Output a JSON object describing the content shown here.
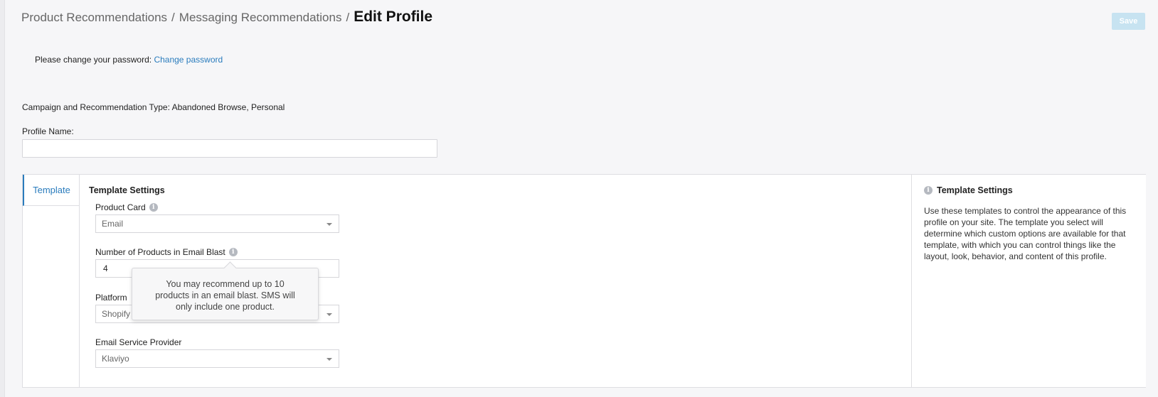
{
  "breadcrumb": {
    "items": [
      "Product Recommendations",
      "Messaging Recommendations"
    ],
    "separator": "/",
    "current": "Edit Profile"
  },
  "header": {
    "save_label": "Save"
  },
  "password_notice": {
    "text": "Please change your password: ",
    "link_label": "Change password"
  },
  "campaign": {
    "text": "Campaign and Recommendation Type: Abandoned Browse, Personal"
  },
  "profile_name": {
    "label": "Profile Name:",
    "value": ""
  },
  "tabs": [
    {
      "label": "Template"
    }
  ],
  "template_settings": {
    "title": "Template Settings",
    "product_card": {
      "label": "Product Card",
      "value": "Email"
    },
    "num_products": {
      "label": "Number of Products in Email Blast",
      "value": "4"
    },
    "platform": {
      "label": "Platform",
      "value": "Shopify"
    },
    "esp": {
      "label": "Email Service Provider",
      "value": "Klaviyo"
    },
    "tooltip": "You may recommend up to 10 products in an email blast. SMS will only include one product."
  },
  "help": {
    "title": "Template Settings",
    "body": "Use these templates to control the appearance of this profile on your site. The template you select will determine which custom options are available for that template, with which you can control things like the layout, look, behavior, and content of this profile."
  },
  "icons": {
    "info": "info-icon",
    "dropdown": "chevron-down-icon"
  },
  "colors": {
    "accent": "#2a7cbd",
    "save_disabled": "#c7e3f1"
  }
}
